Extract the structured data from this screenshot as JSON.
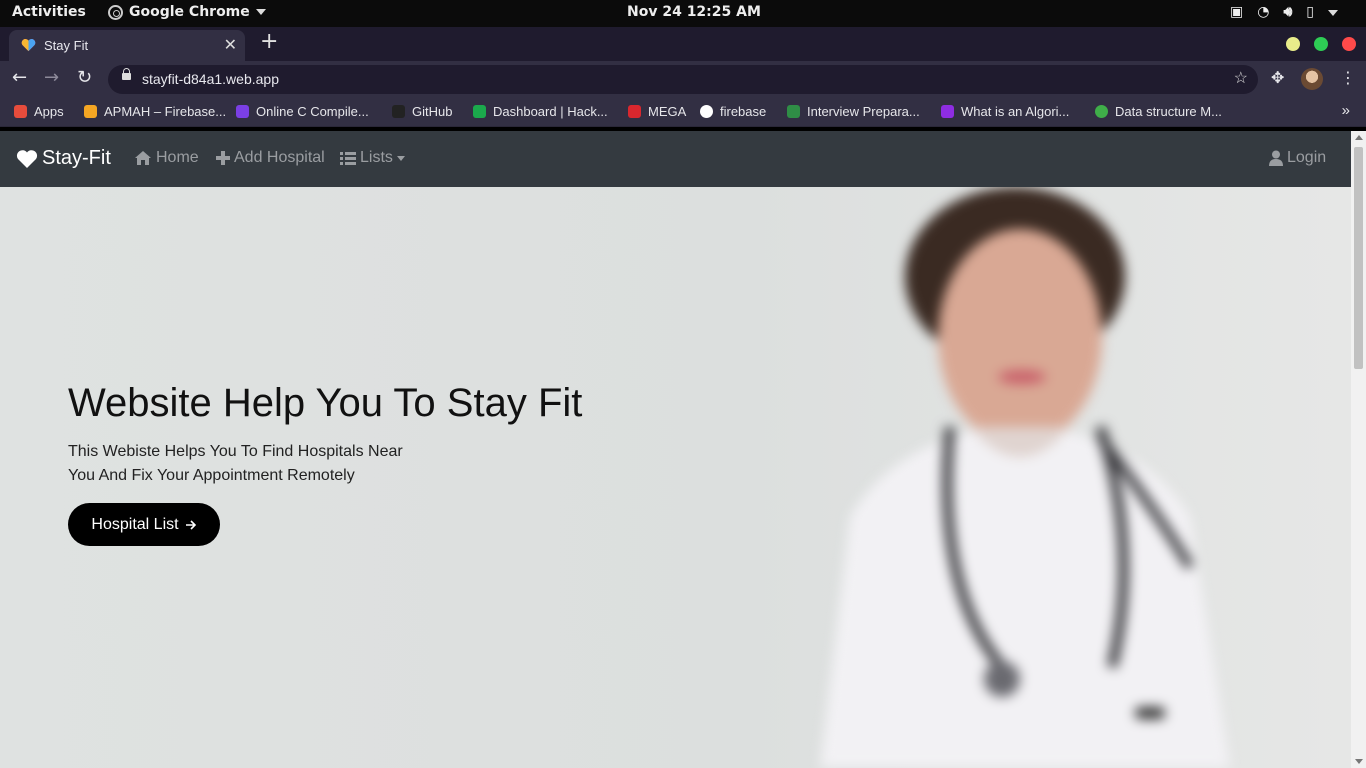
{
  "system_bar": {
    "activities": "Activities",
    "app_name": "Google Chrome",
    "clock": "Nov 24  12:25 AM"
  },
  "browser": {
    "tab_title": "Stay Fit",
    "url": "stayfit-d84a1.web.app",
    "window_colors": [
      "#e8ec8a",
      "#2ecc55",
      "#ff4a4a"
    ],
    "bookmarks": [
      {
        "label": "Apps",
        "icon": "apps-grid-icon",
        "color": "#e74c3c"
      },
      {
        "label": "APMAH – Firebase...",
        "icon": "firebase-icon",
        "color": "#f5a623"
      },
      {
        "label": "Online C Compile...",
        "icon": "bolt-icon",
        "color": "#7b3fe4"
      },
      {
        "label": "GitHub",
        "icon": "github-icon",
        "color": "#222222"
      },
      {
        "label": "Dashboard | Hack...",
        "icon": "hackerrank-icon",
        "color": "#1ba94c"
      },
      {
        "label": "MEGA",
        "icon": "mega-icon",
        "color": "#d9272e"
      },
      {
        "label": "firebase",
        "icon": "globe-icon",
        "color": "#ffffff"
      },
      {
        "label": "Interview Prepara...",
        "icon": "gfg-icon",
        "color": "#2f8d46"
      },
      {
        "label": "What is an Algori...",
        "icon": "question-icon",
        "color": "#8e2de2"
      },
      {
        "label": "Data structure M...",
        "icon": "gfg-circle-icon",
        "color": "#3fae49"
      }
    ]
  },
  "site": {
    "brand": "Stay-Fit",
    "nav": {
      "home": "Home",
      "add_hospital": "Add Hospital",
      "lists": "Lists",
      "login": "Login"
    },
    "hero": {
      "title": "Website Help You To Stay Fit",
      "subtitle_line1": "This Webiste Helps You To Find Hospitals Near",
      "subtitle_line2": "You And Fix Your Appointment Remotely",
      "button": "Hospital List"
    }
  }
}
